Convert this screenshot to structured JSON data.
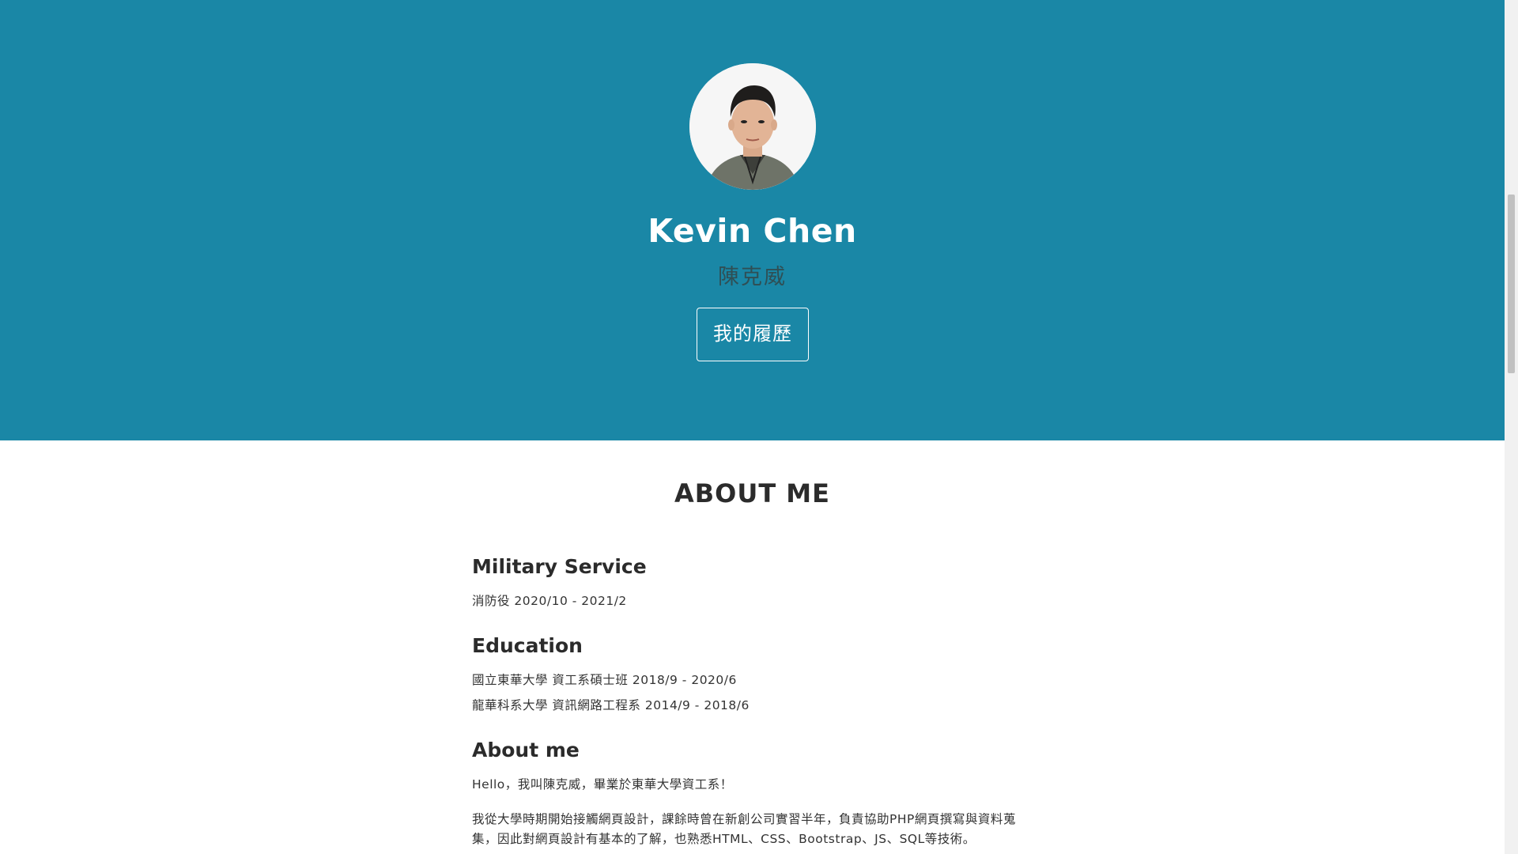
{
  "hero": {
    "name": "Kevin Chen",
    "subname": "陳克威",
    "resume_button": "我的履歷",
    "background_color": "#1a87a6"
  },
  "about": {
    "title": "ABOUT ME",
    "military": {
      "heading": "Military Service",
      "items": [
        "消防役 2020/10 - 2021/2"
      ]
    },
    "education": {
      "heading": "Education",
      "items": [
        "國立東華大學 資工系碩士班 2018/9 - 2020/6",
        "龍華科系大學 資訊網路工程系 2014/9 - 2018/6"
      ]
    },
    "about_me": {
      "heading": "About me",
      "greeting": "Hello，我叫陳克威，畢業於東華大學資工系！",
      "paragraph": "我從大學時期開始接觸網頁設計，課餘時曾在新創公司實習半年，負責協助PHP網頁撰寫與資料蒐集，因此對網頁設計有基本的了解，也熟悉HTML、CSS、Bootstrap、JS、SQL等技術。"
    }
  }
}
